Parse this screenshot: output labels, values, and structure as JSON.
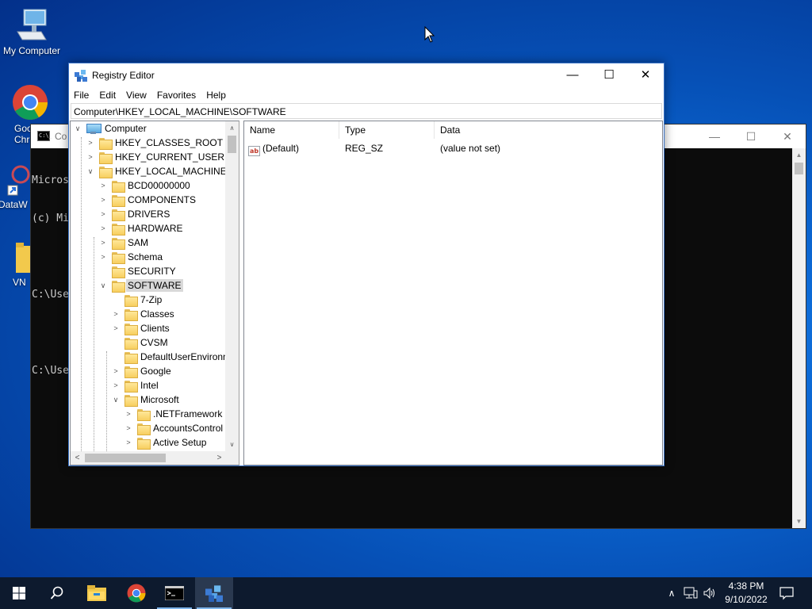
{
  "desktop": {
    "icons": [
      {
        "label": "My Computer",
        "icon": "computer-icon"
      },
      {
        "label": "Goo Chr",
        "icon": "chrome-icon"
      },
      {
        "label": "DataW",
        "icon": "datawrapper-icon"
      },
      {
        "label": "VN",
        "icon": "folder-icon"
      }
    ]
  },
  "cmd_window": {
    "title": "Co",
    "lines": [
      "Micros",
      "(c) Mi",
      "",
      "C:\\Use",
      "",
      "C:\\Use"
    ]
  },
  "regedit": {
    "title": "Registry Editor",
    "menu": [
      "File",
      "Edit",
      "View",
      "Favorites",
      "Help"
    ],
    "address": "Computer\\HKEY_LOCAL_MACHINE\\SOFTWARE",
    "tree": {
      "root": "Computer",
      "hives": [
        "HKEY_CLASSES_ROOT",
        "HKEY_CURRENT_USER",
        "HKEY_LOCAL_MACHINE"
      ],
      "hklm_children": [
        "BCD00000000",
        "COMPONENTS",
        "DRIVERS",
        "HARDWARE",
        "SAM",
        "Schema",
        "SECURITY",
        "SOFTWARE"
      ],
      "selected": "SOFTWARE",
      "software_children": [
        "7-Zip",
        "Classes",
        "Clients",
        "CVSM",
        "DefaultUserEnvironn",
        "Google",
        "Intel",
        "Microsoft"
      ],
      "microsoft_children": [
        ".NETFramework",
        "AccountsControl",
        "Active Setup"
      ]
    },
    "columns": [
      "Name",
      "Type",
      "Data"
    ],
    "values": [
      {
        "name": "(Default)",
        "type": "REG_SZ",
        "data": "(value not set)",
        "icon": "string-value-icon"
      }
    ]
  },
  "taskbar": {
    "apps": [
      "start",
      "search",
      "file-explorer",
      "chrome",
      "command-prompt",
      "registry-editor"
    ],
    "active": "registry-editor",
    "time": "4:38 PM",
    "date": "9/10/2022"
  },
  "colors": {
    "desktop_blue": "#0c6ad6",
    "taskbar": "#0d1a2e",
    "selection": "#d9d9d9",
    "folder": "#f7cf5f"
  }
}
